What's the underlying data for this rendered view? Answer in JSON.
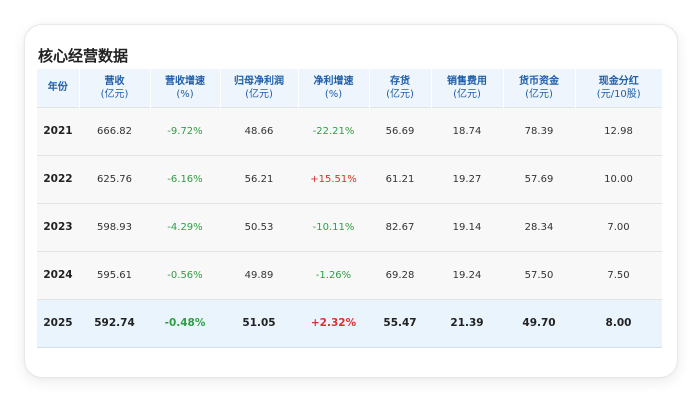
{
  "title": "核心经营数据",
  "headers": [
    {
      "l1": "年份",
      "l2": ""
    },
    {
      "l1": "营收",
      "l2": "(亿元)"
    },
    {
      "l1": "营收增速",
      "l2": "(%)"
    },
    {
      "l1": "归母净利润",
      "l2": "(亿元)"
    },
    {
      "l1": "净利增速",
      "l2": "(%)"
    },
    {
      "l1": "存货",
      "l2": "(亿元)"
    },
    {
      "l1": "销售费用",
      "l2": "(亿元)"
    },
    {
      "l1": "货币资金",
      "l2": "(亿元)"
    },
    {
      "l1": "现金分红",
      "l2": "(元/10股)"
    }
  ],
  "rows": [
    {
      "year": "2021",
      "revenue": "666.82",
      "rev_growth": "-9.72%",
      "net_profit": "48.66",
      "np_growth": "-22.21%",
      "inventory": "56.69",
      "sales_exp": "18.74",
      "cash": "78.39",
      "dividend": "12.98"
    },
    {
      "year": "2022",
      "revenue": "625.76",
      "rev_growth": "-6.16%",
      "net_profit": "56.21",
      "np_growth": "+15.51%",
      "inventory": "61.21",
      "sales_exp": "19.27",
      "cash": "57.69",
      "dividend": "10.00"
    },
    {
      "year": "2023",
      "revenue": "598.93",
      "rev_growth": "-4.29%",
      "net_profit": "50.53",
      "np_growth": "-10.11%",
      "inventory": "82.67",
      "sales_exp": "19.14",
      "cash": "28.34",
      "dividend": "7.00"
    },
    {
      "year": "2024",
      "revenue": "595.61",
      "rev_growth": "-0.56%",
      "net_profit": "49.89",
      "np_growth": "-1.26%",
      "inventory": "69.28",
      "sales_exp": "19.24",
      "cash": "57.50",
      "dividend": "7.50"
    },
    {
      "year": "2025",
      "revenue": "592.74",
      "rev_growth": "-0.48%",
      "net_profit": "51.05",
      "np_growth": "+2.32%",
      "inventory": "55.47",
      "sales_exp": "21.39",
      "cash": "49.70",
      "dividend": "8.00"
    }
  ],
  "colors": {
    "header_bg": "#eef5fd",
    "header_text": "#1f5fa8",
    "negative": "#2f9e44",
    "positive": "#d6332f",
    "highlight_row": "#eaf4fd"
  }
}
